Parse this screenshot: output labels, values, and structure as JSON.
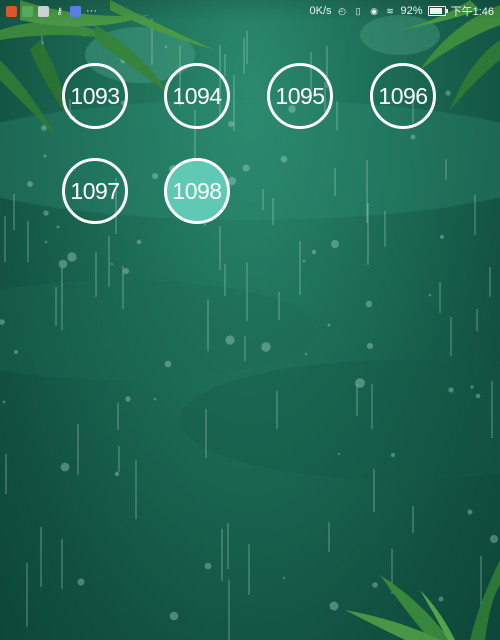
{
  "status_bar": {
    "left_icons": [
      "notification-app-icon",
      "notification-app-icon",
      "sd-card-icon",
      "key-icon",
      "notification-app-icon"
    ],
    "more_indicator": "···",
    "net_speed": "0K/s",
    "battery_percent": "92%",
    "battery_level": 0.92,
    "time": "下午1:46"
  },
  "levels": [
    {
      "label": "1093",
      "state": "normal"
    },
    {
      "label": "1094",
      "state": "normal"
    },
    {
      "label": "1095",
      "state": "normal"
    },
    {
      "label": "1096",
      "state": "normal"
    },
    {
      "label": "1097",
      "state": "normal"
    },
    {
      "label": "1098",
      "state": "current"
    }
  ],
  "colors": {
    "background_top": "#2b8a6e",
    "background_bottom": "#0d463a",
    "circle_border": "#ffffff",
    "current_fill": "#5fc9b4"
  }
}
